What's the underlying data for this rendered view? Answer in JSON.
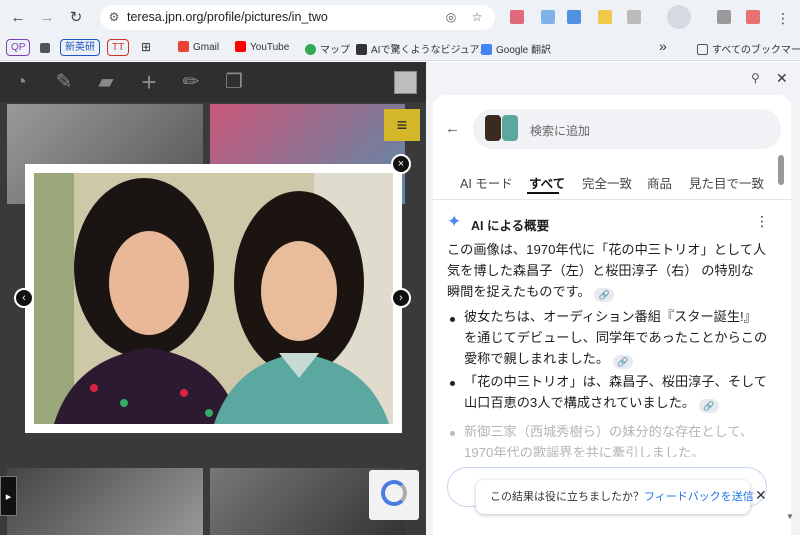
{
  "browser": {
    "url": "teresa.jpn.org/profile/pictures/in_two",
    "back_icon": "←",
    "forward_icon": "→",
    "reload_icon": "↻",
    "bookmarks": [
      {
        "label": "QP",
        "color": "#7b3fb8"
      },
      {
        "label": "新英研",
        "color": "#1a56c4"
      },
      {
        "label": "TT",
        "color": "#d0312d"
      },
      {
        "label": "Gmail"
      },
      {
        "label": "YouTube"
      },
      {
        "label": "マップ"
      },
      {
        "label": "AIで驚くようなビジュア..."
      },
      {
        "label": "Google 翻訳"
      }
    ],
    "all_bookmarks": "すべてのブックマーク",
    "more_icon": "»"
  },
  "page": {
    "menu_icon": "≡",
    "prev_icon": "‹",
    "next_icon": "›",
    "close_icon": "×",
    "side_arrow": "▸"
  },
  "lens": {
    "search_placeholder": "検索に追加",
    "tabs": [
      "AI モード",
      "すべて",
      "完全一致",
      "商品",
      "見た目で一致"
    ],
    "active_tab": 1,
    "overview_title": "AI による概要",
    "summary": "この画像は、1970年代に「花の中三トリオ」として人気を博した森昌子（左）と桜田淳子（右） の特別な瞬間を捉えたものです。",
    "bullets": [
      "彼女たちは、オーディション番組『スター誕生!』を通じてデビューし、同学年であったことからこの愛称で親しまれました。",
      "「花の中三トリオ」は、森昌子、桜田淳子、そして山口百恵の3人で構成されていました。",
      "新御三家（西城秀樹ら）の妹分的な存在として、1970年代の歌謡界を共に牽引しました。"
    ],
    "feedback_question": "この結果は役に立ちましたか？",
    "feedback_link": "フィードバックを送信",
    "accent": "#1a73e8"
  }
}
